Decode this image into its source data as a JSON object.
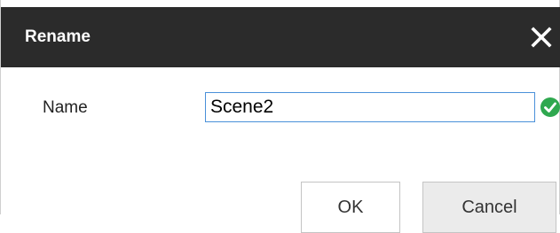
{
  "dialog": {
    "title": "Rename",
    "close_icon": "close-icon",
    "name_label": "Name",
    "name_value": "Scene2",
    "valid_icon": "check-circle-icon",
    "valid_color": "#2fa84f",
    "ok_label": "OK",
    "cancel_label": "Cancel",
    "titlebar_color": "#2b2b2b"
  }
}
